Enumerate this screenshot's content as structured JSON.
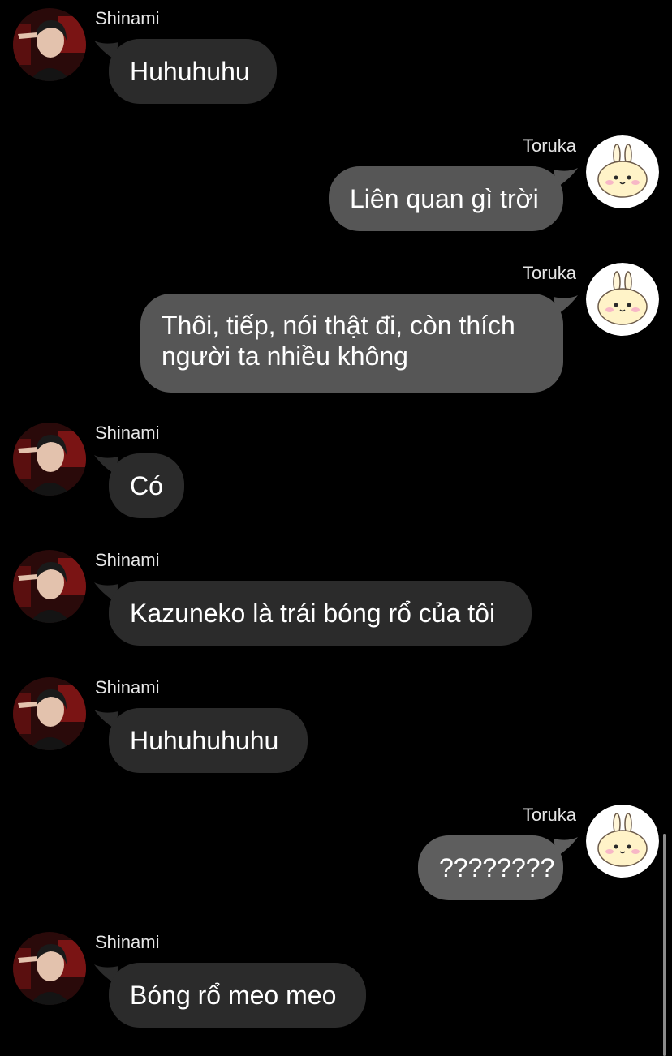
{
  "colors": {
    "background": "#000000",
    "incoming_bubble": "#2b2b2b",
    "outgoing_bubble": "#565656",
    "text": "#ffffff",
    "sender_name": "#e6e6e6"
  },
  "messages": [
    {
      "side": "left",
      "sender": "Shinami",
      "avatar": "shinami-avatar",
      "text": "Huhuhuhu"
    },
    {
      "side": "right",
      "sender": "Toruka",
      "avatar": "bunny-avatar",
      "text": "Liên quan gì trời"
    },
    {
      "side": "right",
      "sender": "Toruka",
      "avatar": "bunny-avatar",
      "lines": [
        "Thôi, tiếp, nói thật đi, còn thích",
        "người ta nhiều không"
      ]
    },
    {
      "side": "left",
      "sender": "Shinami",
      "avatar": "shinami-avatar",
      "text": "Có"
    },
    {
      "side": "left",
      "sender": "Shinami",
      "avatar": "shinami-avatar",
      "text": "Kazuneko là trái bóng rổ của tôi"
    },
    {
      "side": "left",
      "sender": "Shinami",
      "avatar": "shinami-avatar",
      "text": "Huhuhuhuhu"
    },
    {
      "side": "right",
      "sender": "Toruka",
      "avatar": "bunny-avatar",
      "text": "????????"
    },
    {
      "side": "left",
      "sender": "Shinami",
      "avatar": "shinami-avatar",
      "text": "Bóng rổ meo meo"
    }
  ]
}
